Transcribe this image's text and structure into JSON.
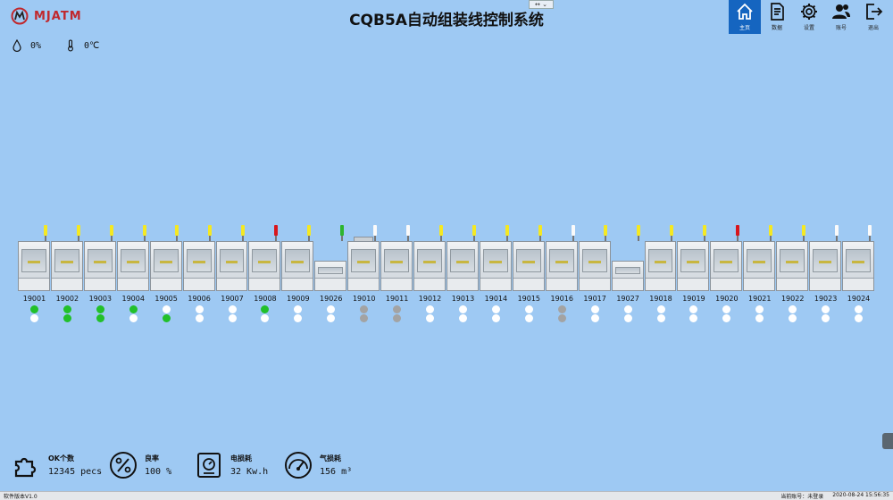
{
  "header": {
    "logo_text": "MJATM",
    "title": "CQB5A自动组装线控制系统",
    "window_ctl": "↔ ⌄"
  },
  "environment": {
    "humidity": "0%",
    "temperature": "0℃"
  },
  "nav": [
    {
      "label": "主页",
      "icon": "home-icon",
      "active": true
    },
    {
      "label": "数据",
      "icon": "document-icon",
      "active": false
    },
    {
      "label": "设置",
      "icon": "gear-icon",
      "active": false
    },
    {
      "label": "账号",
      "icon": "users-icon",
      "active": false
    },
    {
      "label": "退出",
      "icon": "exit-icon",
      "active": false
    }
  ],
  "stations": [
    {
      "id": "19001",
      "light": "yellow",
      "dots": [
        "green",
        "white"
      ]
    },
    {
      "id": "19002",
      "light": "yellow",
      "dots": [
        "green",
        "green"
      ]
    },
    {
      "id": "19003",
      "light": "yellow",
      "dots": [
        "green",
        "green"
      ]
    },
    {
      "id": "19004",
      "light": "yellow",
      "dots": [
        "green",
        "white"
      ]
    },
    {
      "id": "19005",
      "light": "yellow",
      "dots": [
        "white",
        "green"
      ]
    },
    {
      "id": "19006",
      "light": "yellow",
      "dots": [
        "white",
        "white"
      ]
    },
    {
      "id": "19007",
      "light": "yellow",
      "dots": [
        "white",
        "white"
      ]
    },
    {
      "id": "19008",
      "light": "red",
      "dots": [
        "green",
        "white"
      ]
    },
    {
      "id": "19009",
      "light": "yellow",
      "dots": [
        "white",
        "white"
      ]
    },
    {
      "id": "19026",
      "light": "green",
      "dots": [
        "white",
        "white"
      ]
    },
    {
      "id": "19010",
      "light": "white",
      "dots": [
        "gray",
        "gray"
      ]
    },
    {
      "id": "19011",
      "light": "white",
      "dots": [
        "gray",
        "gray"
      ]
    },
    {
      "id": "19012",
      "light": "yellow",
      "dots": [
        "white",
        "white"
      ]
    },
    {
      "id": "19013",
      "light": "yellow",
      "dots": [
        "white",
        "white"
      ]
    },
    {
      "id": "19014",
      "light": "yellow",
      "dots": [
        "white",
        "white"
      ]
    },
    {
      "id": "19015",
      "light": "yellow",
      "dots": [
        "white",
        "white"
      ]
    },
    {
      "id": "19016",
      "light": "white",
      "dots": [
        "gray",
        "gray"
      ]
    },
    {
      "id": "19017",
      "light": "yellow",
      "dots": [
        "white",
        "white"
      ]
    },
    {
      "id": "19027",
      "light": "yellow",
      "dots": [
        "white",
        "white"
      ]
    },
    {
      "id": "19018",
      "light": "yellow",
      "dots": [
        "white",
        "white"
      ]
    },
    {
      "id": "19019",
      "light": "yellow",
      "dots": [
        "white",
        "white"
      ]
    },
    {
      "id": "19020",
      "light": "red",
      "dots": [
        "white",
        "white"
      ]
    },
    {
      "id": "19021",
      "light": "yellow",
      "dots": [
        "white",
        "white"
      ]
    },
    {
      "id": "19022",
      "light": "yellow",
      "dots": [
        "white",
        "white"
      ]
    },
    {
      "id": "19023",
      "light": "white",
      "dots": [
        "white",
        "white"
      ]
    },
    {
      "id": "19024",
      "light": "white",
      "dots": [
        "white",
        "white"
      ]
    }
  ],
  "light_colors": {
    "yellow": "#f4e823",
    "red": "#d8161c",
    "green": "#2db52d",
    "white": "#fafafa"
  },
  "stats": {
    "ok_count": {
      "label": "OK个数",
      "value": "12345 pecs"
    },
    "yield": {
      "label": "良率",
      "value": "100 %"
    },
    "power": {
      "label": "电损耗",
      "value": "32 Kw.h"
    },
    "gas": {
      "label": "气损耗",
      "value": "156 m³"
    }
  },
  "statusbar": {
    "version": "软件版本V1.0",
    "account": "当前账号：未登录",
    "datetime": "2020-08-24 15:56:35"
  }
}
